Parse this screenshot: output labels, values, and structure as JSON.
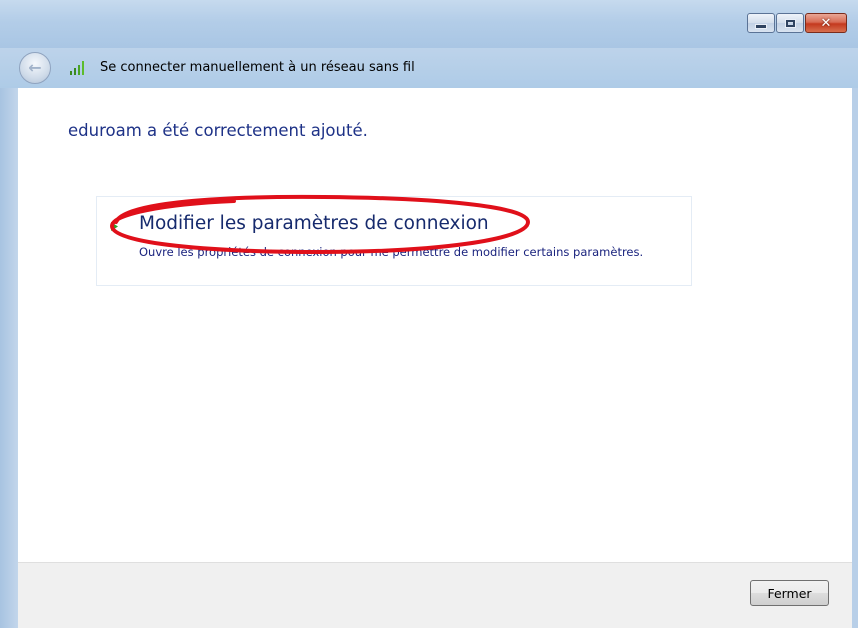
{
  "window": {
    "nav_title": "Se connecter manuellement à un réseau sans fil",
    "icons": {
      "back": "back-arrow-icon",
      "signal": "wireless-signal-icon",
      "task_arrow": "green-arrow-icon"
    }
  },
  "content": {
    "heading": "eduroam a été correctement ajouté.",
    "task": {
      "title": "Modifier les paramètres de connexion",
      "description": "Ouvre les propriétés de connexion pour me permettre de modifier certains paramètres."
    }
  },
  "footer": {
    "close_label": "Fermer"
  },
  "colors": {
    "heading": "#1e3287",
    "annotation": "#e0101a",
    "titlebar": "#b3cde8"
  }
}
